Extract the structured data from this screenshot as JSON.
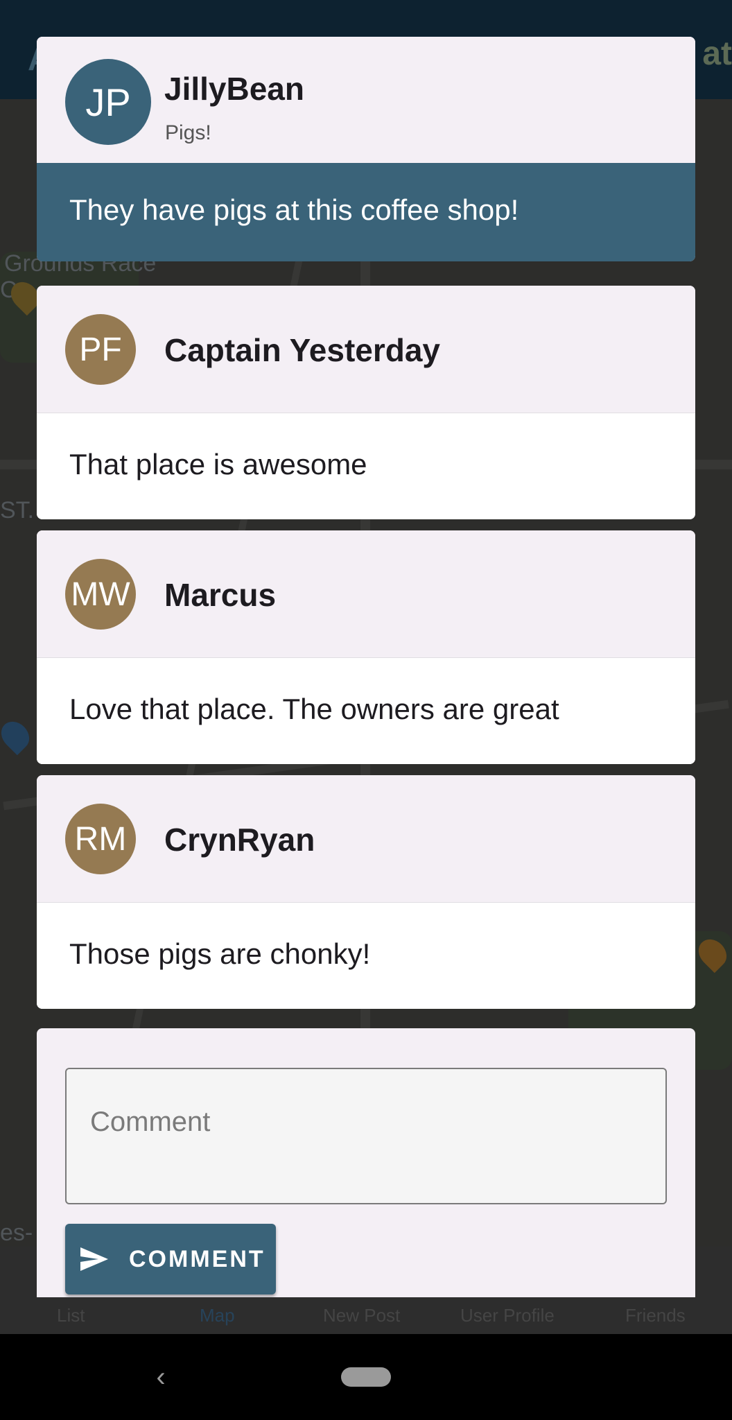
{
  "background": {
    "appbar_title": "A",
    "appbar_right": "at",
    "map_labels": [
      "Grounds Race",
      "C",
      "ST.",
      "es-"
    ],
    "bottom_nav": [
      "List",
      "Map",
      "New Post",
      "User Profile",
      "Friends"
    ],
    "active_nav": "Map"
  },
  "post": {
    "avatar_initials": "JP",
    "author": "JillyBean",
    "title": "Pigs!",
    "body": "They have pigs at this coffee shop!",
    "avatar_color": "#3a6379"
  },
  "comments": [
    {
      "initials": "PF",
      "author": "Captain Yesterday",
      "text": "That place is awesome"
    },
    {
      "initials": "MW",
      "author": "Marcus",
      "text": "Love that place. The owners are great"
    },
    {
      "initials": "RM",
      "author": "CrynRyan",
      "text": "Those pigs are chonky!"
    }
  ],
  "comment_form": {
    "placeholder": "Comment",
    "button_label": "COMMENT",
    "button_icon": "send-icon"
  },
  "colors": {
    "primary": "#3a6379",
    "comment_avatar": "#957a52",
    "card_header": "#f4eff5"
  }
}
